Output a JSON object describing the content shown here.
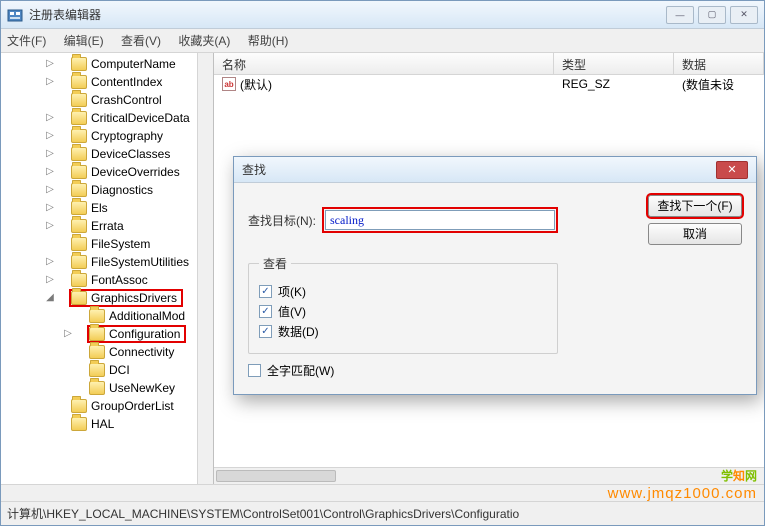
{
  "window": {
    "title": "注册表编辑器",
    "min": "—",
    "max": "▢",
    "close": "✕"
  },
  "menu": {
    "file": "文件(F)",
    "edit": "编辑(E)",
    "view": "查看(V)",
    "favorites": "收藏夹(A)",
    "help": "帮助(H)"
  },
  "tree": {
    "items": [
      {
        "label": "ComputerName",
        "level": 0,
        "exp": "▷"
      },
      {
        "label": "ContentIndex",
        "level": 0,
        "exp": "▷"
      },
      {
        "label": "CrashControl",
        "level": 0,
        "exp": ""
      },
      {
        "label": "CriticalDeviceData",
        "level": 0,
        "exp": "▷"
      },
      {
        "label": "Cryptography",
        "level": 0,
        "exp": "▷"
      },
      {
        "label": "DeviceClasses",
        "level": 0,
        "exp": "▷"
      },
      {
        "label": "DeviceOverrides",
        "level": 0,
        "exp": "▷"
      },
      {
        "label": "Diagnostics",
        "level": 0,
        "exp": "▷"
      },
      {
        "label": "Els",
        "level": 0,
        "exp": "▷"
      },
      {
        "label": "Errata",
        "level": 0,
        "exp": "▷"
      },
      {
        "label": "FileSystem",
        "level": 0,
        "exp": ""
      },
      {
        "label": "FileSystemUtilities",
        "level": 0,
        "exp": "▷"
      },
      {
        "label": "FontAssoc",
        "level": 0,
        "exp": "▷"
      },
      {
        "label": "GraphicsDrivers",
        "level": 0,
        "exp": "◢",
        "highlight": true
      },
      {
        "label": "AdditionalMod",
        "level": 1,
        "exp": ""
      },
      {
        "label": "Configuration",
        "level": 1,
        "exp": "▷",
        "highlight": true
      },
      {
        "label": "Connectivity",
        "level": 1,
        "exp": ""
      },
      {
        "label": "DCI",
        "level": 1,
        "exp": ""
      },
      {
        "label": "UseNewKey",
        "level": 1,
        "exp": ""
      },
      {
        "label": "GroupOrderList",
        "level": 0,
        "exp": ""
      },
      {
        "label": "HAL",
        "level": 0,
        "exp": ""
      }
    ]
  },
  "list": {
    "headers": {
      "name": "名称",
      "type": "类型",
      "data": "数据"
    },
    "row": {
      "icon": "ab",
      "name": "(默认)",
      "type": "REG_SZ",
      "data": "(数值未设"
    }
  },
  "find": {
    "title": "查找",
    "label": "查找目标(N):",
    "value": "scaling",
    "find_next": "查找下一个(F)",
    "cancel": "取消",
    "look_at": "查看",
    "chk_keys": "项(K)",
    "chk_values": "值(V)",
    "chk_data": "数据(D)",
    "whole": "全字匹配(W)"
  },
  "statusbar": "计算机\\HKEY_LOCAL_MACHINE\\SYSTEM\\ControlSet001\\Control\\GraphicsDrivers\\Configuratio",
  "watermark": {
    "text1": "学",
    "text2": "知",
    "text3": "网",
    "url": "www.jmqz1000.com"
  }
}
